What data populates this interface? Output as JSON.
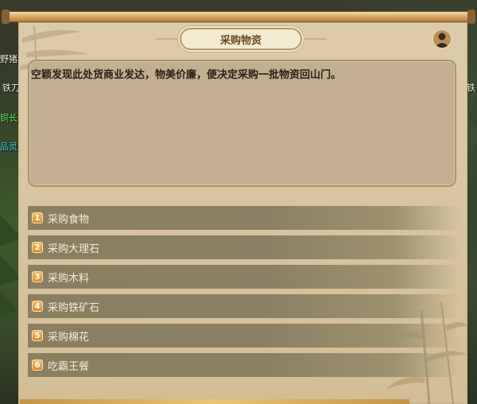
{
  "world": {
    "labels": [
      "野猪林",
      "铁刀",
      "铜长",
      "品灵",
      "铁"
    ]
  },
  "dialog": {
    "title": "采购物资",
    "text": "空颖发现此处货商业发达，物美价廉，便决定采购一批物资回山门。",
    "avatar_icon": "character-portrait-icon"
  },
  "options": [
    {
      "num": "1",
      "label": "采购食物"
    },
    {
      "num": "2",
      "label": "采购大理石"
    },
    {
      "num": "3",
      "label": "采购木料"
    },
    {
      "num": "4",
      "label": "采购铁矿石"
    },
    {
      "num": "5",
      "label": "采购棉花"
    },
    {
      "num": "6",
      "label": "吃霸王餐"
    }
  ],
  "colors": {
    "parchment": "#d6c39f",
    "dialog_box": "#c2ae90",
    "option_bar": "#8a7f60",
    "number_badge": "#e59f42",
    "title_text": "#6b4a22"
  }
}
